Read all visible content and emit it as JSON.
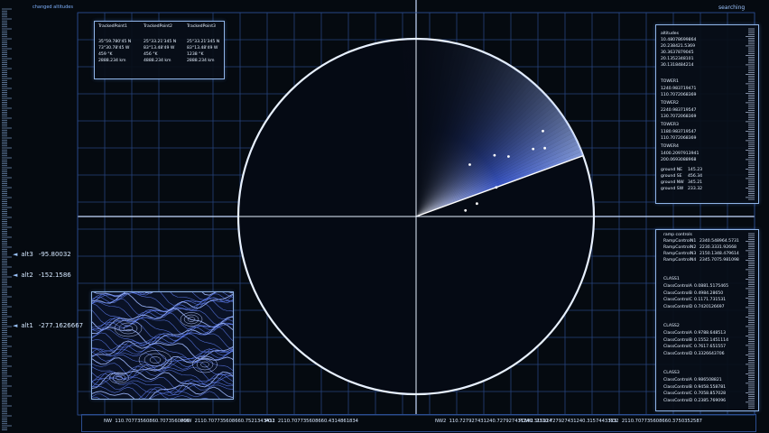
{
  "header": {
    "top_left_label": "changed altitudes",
    "status": "searching"
  },
  "tracked_panel": {
    "columns": [
      "TrackedPoint1",
      "TrackedPoint2",
      "TrackedPoint3"
    ],
    "rows": [
      [
        "35°59.780'45 N",
        "25°33.21'345 N",
        "25°33.21'345 N"
      ],
      [
        "73°30.78'45 W",
        "83°13.48'49 W",
        "83°13.48'49 W"
      ],
      [
        "459 °K",
        "456 °K",
        "1238 °K"
      ],
      [
        "2888.234 km",
        "4888.234 km",
        "2888.234 km"
      ]
    ]
  },
  "right_top_panel": {
    "altitudes_label": "altitudes",
    "altitudes": [
      "10.48078699864",
      "20.238421.5369",
      "30.3637879045",
      "20.1352348101",
      "30.1318484214"
    ],
    "towers": [
      {
        "name": "TOWER1",
        "values": [
          "1240.983719471",
          "110.7072068369"
        ]
      },
      {
        "name": "TOWER2",
        "values": [
          "2240.983719547",
          "130.7072068369"
        ]
      },
      {
        "name": "TOWER3",
        "values": [
          "1180.983719547",
          "110.7072068369"
        ]
      },
      {
        "name": "TOWER4",
        "values": [
          "1400.2097913941",
          "200.0693088968"
        ]
      }
    ],
    "ground": [
      {
        "label": "ground NE",
        "value": "145.23"
      },
      {
        "label": "ground SE",
        "value": "456.34"
      },
      {
        "label": "ground NW",
        "value": "345.21"
      },
      {
        "label": "ground SW",
        "value": "233.32"
      }
    ]
  },
  "right_bottom_panel": {
    "ramp_label": "ramp controls",
    "ramp": [
      {
        "label": "RampControlN1",
        "value": "2340.548964.5731"
      },
      {
        "label": "RampControlN2",
        "value": "2230.3331.92668"
      },
      {
        "label": "RampControlN3",
        "value": "2150.1348.479614"
      },
      {
        "label": "RampControlN4",
        "value": "2345.7075.981098"
      }
    ],
    "classes": [
      {
        "name": "CLASS1",
        "items": [
          {
            "label": "ClassControlA",
            "value": "0.0881.5175465"
          },
          {
            "label": "ClassControlB",
            "value": "0.4984.28650"
          },
          {
            "label": "ClassControlC",
            "value": "0.1171.731531"
          },
          {
            "label": "ClassControlD",
            "value": "0.7420126697"
          }
        ]
      },
      {
        "name": "CLASS2",
        "items": [
          {
            "label": "ClassControlA",
            "value": "0.9788.648513"
          },
          {
            "label": "ClassControlB",
            "value": "0.1552.1451114"
          },
          {
            "label": "ClassControlC",
            "value": "0.7617.651557"
          },
          {
            "label": "ClassControlD",
            "value": "0.3326643706"
          }
        ]
      },
      {
        "name": "CLASS3",
        "items": [
          {
            "label": "ClassControlA",
            "value": "0.986508821"
          },
          {
            "label": "ClassControlB",
            "value": "0.9458.558781"
          },
          {
            "label": "ClassControlC",
            "value": "0.7058.857028"
          },
          {
            "label": "ClassControlD",
            "value": "0.2385.769096"
          }
        ]
      }
    ]
  },
  "altimeters": [
    {
      "label": "alt3",
      "value": "-95.80032"
    },
    {
      "label": "alt2",
      "value": "-152.1586"
    },
    {
      "label": "alt1",
      "value": "-277.1626667"
    }
  ],
  "bottom_bar": {
    "nw1_label": "NW",
    "nw1_value": "110.70773560860.7073560866",
    "pow1_label": "POW",
    "pow1_value": "2110.707735608660.7521343411",
    "pos2a_label": "PO2",
    "pos2a_value": "2110.707735608660.4314861834",
    "nw2_label": "NW2",
    "nw2_value": "110.727927431240.727927431240.315124",
    "pow2_label": "POW2",
    "pow2_value": "2110.727927431240.3157443323",
    "pos2b_label": "PO2",
    "pos2b_value": "2110.707735608660.3750352587"
  },
  "radar": {
    "sweep_angle_deg": -20,
    "blips": [
      {
        "r": 0.42,
        "a": -44
      },
      {
        "r": 0.56,
        "a": -38
      },
      {
        "r": 0.62,
        "a": -33
      },
      {
        "r": 0.76,
        "a": -30
      },
      {
        "r": 0.82,
        "a": -28
      },
      {
        "r": 0.48,
        "a": -20
      },
      {
        "r": 0.35,
        "a": -12
      },
      {
        "r": 0.28,
        "a": -7
      },
      {
        "r": 0.86,
        "a": -34
      }
    ]
  }
}
